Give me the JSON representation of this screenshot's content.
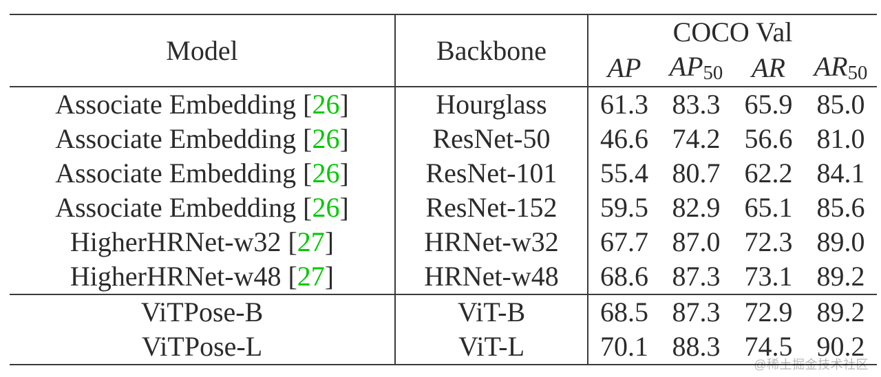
{
  "chart_data": {
    "type": "table",
    "title": "COCO Val results by model and backbone",
    "columns": [
      "Model",
      "Backbone",
      "AP",
      "AP50",
      "AR",
      "AR50"
    ],
    "rows": [
      {
        "model": "Associate Embedding",
        "ref": 26,
        "backbone": "Hourglass",
        "AP": 61.3,
        "AP50": 83.3,
        "AR": 65.9,
        "AR50": 85.0
      },
      {
        "model": "Associate Embedding",
        "ref": 26,
        "backbone": "ResNet-50",
        "AP": 46.6,
        "AP50": 74.2,
        "AR": 56.6,
        "AR50": 81.0
      },
      {
        "model": "Associate Embedding",
        "ref": 26,
        "backbone": "ResNet-101",
        "AP": 55.4,
        "AP50": 80.7,
        "AR": 62.2,
        "AR50": 84.1
      },
      {
        "model": "Associate Embedding",
        "ref": 26,
        "backbone": "ResNet-152",
        "AP": 59.5,
        "AP50": 82.9,
        "AR": 65.1,
        "AR50": 85.6
      },
      {
        "model": "HigherHRNet-w32",
        "ref": 27,
        "backbone": "HRNet-w32",
        "AP": 67.7,
        "AP50": 87.0,
        "AR": 72.3,
        "AR50": 89.0
      },
      {
        "model": "HigherHRNet-w48",
        "ref": 27,
        "backbone": "HRNet-w48",
        "AP": 68.6,
        "AP50": 87.3,
        "AR": 73.1,
        "AR50": 89.2
      },
      {
        "model": "ViTPose-B",
        "ref": null,
        "backbone": "ViT-B",
        "AP": 68.5,
        "AP50": 87.3,
        "AR": 72.9,
        "AR50": 89.2
      },
      {
        "model": "ViTPose-L",
        "ref": null,
        "backbone": "ViT-L",
        "AP": 70.1,
        "AP50": 88.3,
        "AR": 74.5,
        "AR50": 90.2
      }
    ]
  },
  "header": {
    "model": "Model",
    "backbone": "Backbone",
    "supercol": "COCO Val",
    "ap": "AP",
    "ap50_base": "AP",
    "ap50_sub": "50",
    "ar": "AR",
    "ar50_base": "AR",
    "ar50_sub": "50"
  },
  "rows": [
    {
      "model_pre": "Associate Embedding [",
      "ref": "26",
      "model_post": "]",
      "backbone": "Hourglass",
      "ap": "61.3",
      "ap50": "83.3",
      "ar": "65.9",
      "ar50": "85.0"
    },
    {
      "model_pre": "Associate Embedding [",
      "ref": "26",
      "model_post": "]",
      "backbone": "ResNet-50",
      "ap": "46.6",
      "ap50": "74.2",
      "ar": "56.6",
      "ar50": "81.0"
    },
    {
      "model_pre": "Associate Embedding [",
      "ref": "26",
      "model_post": "]",
      "backbone": "ResNet-101",
      "ap": "55.4",
      "ap50": "80.7",
      "ar": "62.2",
      "ar50": "84.1"
    },
    {
      "model_pre": "Associate Embedding [",
      "ref": "26",
      "model_post": "]",
      "backbone": "ResNet-152",
      "ap": "59.5",
      "ap50": "82.9",
      "ar": "65.1",
      "ar50": "85.6"
    },
    {
      "model_pre": "HigherHRNet-w32 [",
      "ref": "27",
      "model_post": "]",
      "backbone": "HRNet-w32",
      "ap": "67.7",
      "ap50": "87.0",
      "ar": "72.3",
      "ar50": "89.0"
    },
    {
      "model_pre": "HigherHRNet-w48 [",
      "ref": "27",
      "model_post": "]",
      "backbone": "HRNet-w48",
      "ap": "68.6",
      "ap50": "87.3",
      "ar": "73.1",
      "ar50": "89.2"
    },
    {
      "model_pre": "ViTPose-B",
      "ref": "",
      "model_post": "",
      "backbone": "ViT-B",
      "ap": "68.5",
      "ap50": "87.3",
      "ar": "72.9",
      "ar50": "89.2"
    },
    {
      "model_pre": "ViTPose-L",
      "ref": "",
      "model_post": "",
      "backbone": "ViT-L",
      "ap": "70.1",
      "ap50": "88.3",
      "ar": "74.5",
      "ar50": "90.2"
    }
  ],
  "watermark": "@稀土掘金技术社区"
}
